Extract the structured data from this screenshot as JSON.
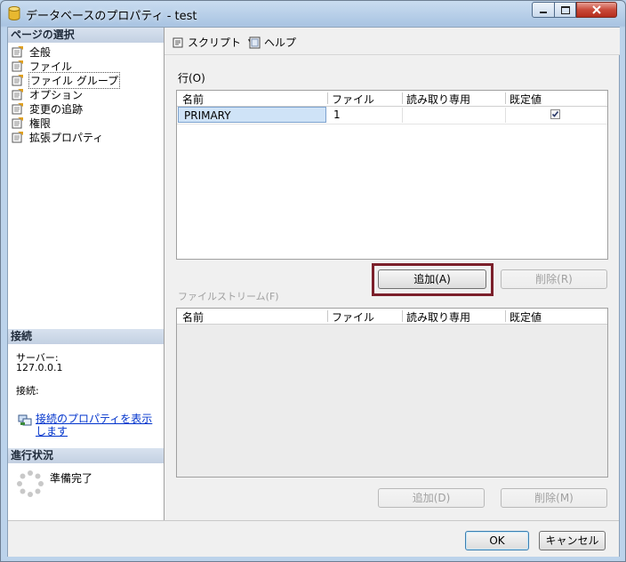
{
  "window": {
    "title": "データベースのプロパティ - test",
    "controls": {
      "minimize": "minimize",
      "maximize": "maximize",
      "close": "close"
    }
  },
  "sidebar": {
    "page_select_header": "ページの選択",
    "pages": [
      {
        "label": "全般",
        "icon": "page-icon"
      },
      {
        "label": "ファイル",
        "icon": "page-icon"
      },
      {
        "label": "ファイル グループ",
        "icon": "page-icon",
        "selected": true
      },
      {
        "label": "オプション",
        "icon": "page-icon"
      },
      {
        "label": "変更の追跡",
        "icon": "page-icon"
      },
      {
        "label": "権限",
        "icon": "page-icon"
      },
      {
        "label": "拡張プロパティ",
        "icon": "page-icon"
      }
    ],
    "connection_header": "接続",
    "server_label": "サーバー:",
    "server_value": "127.0.0.1",
    "connection_label": "接続:",
    "connection_link": "接続のプロパティを表示します",
    "progress_header": "進行状況",
    "progress_status": "準備完了"
  },
  "toolbar": {
    "script_label": "スクリプト",
    "help_label": "ヘルプ"
  },
  "rows_section": {
    "title": "行(O)",
    "columns": [
      "名前",
      "ファイル",
      "読み取り専用",
      "既定値"
    ],
    "rows": [
      {
        "name": "PRIMARY",
        "files": "1",
        "read_only": "",
        "default": true
      }
    ],
    "add_button": "追加(A)",
    "remove_button": "削除(R)"
  },
  "filestream_section": {
    "title": "ファイルストリーム(F)",
    "columns": [
      "名前",
      "ファイル",
      "読み取り専用",
      "既定値"
    ],
    "add_button": "追加(D)",
    "remove_button": "削除(M)"
  },
  "dialog_buttons": {
    "ok": "OK",
    "cancel": "キャンセル"
  },
  "colors": {
    "highlight_border": "#7b1f2a",
    "selected_cell": "#cfe3f7",
    "link": "#0033cc"
  }
}
